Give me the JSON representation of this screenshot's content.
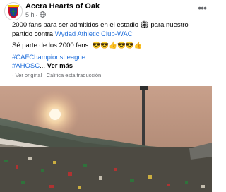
{
  "page": {
    "name": "Accra Hearts of Oak",
    "time": "5 h",
    "more_icon": "more-horizontal-icon",
    "audience_icon": "globe-icon"
  },
  "post": {
    "line1_a": "2000 fans para ser admitidos en el estadio ",
    "line1_emoji": "🏟",
    "line1_b": " para nuestro partido contra ",
    "line1_link": "Wydad Athletic Club-WAC",
    "line2": "Sé parte de los 2000 fans. 😎😎👍😎😎👍",
    "hashtag1": "#CAFChampionsLeague",
    "hashtag2": "#AHOSC",
    "ellipsis": "... ",
    "see_more": "Ver más"
  },
  "translation": {
    "original": "Ver original",
    "rate": "Califica esta traducción"
  },
  "colors": {
    "link": "#216fdb",
    "secondary": "#65676b",
    "crest_green": "#1a7a3c",
    "crest_red": "#c8102e",
    "crest_blue": "#1d3f8f"
  }
}
